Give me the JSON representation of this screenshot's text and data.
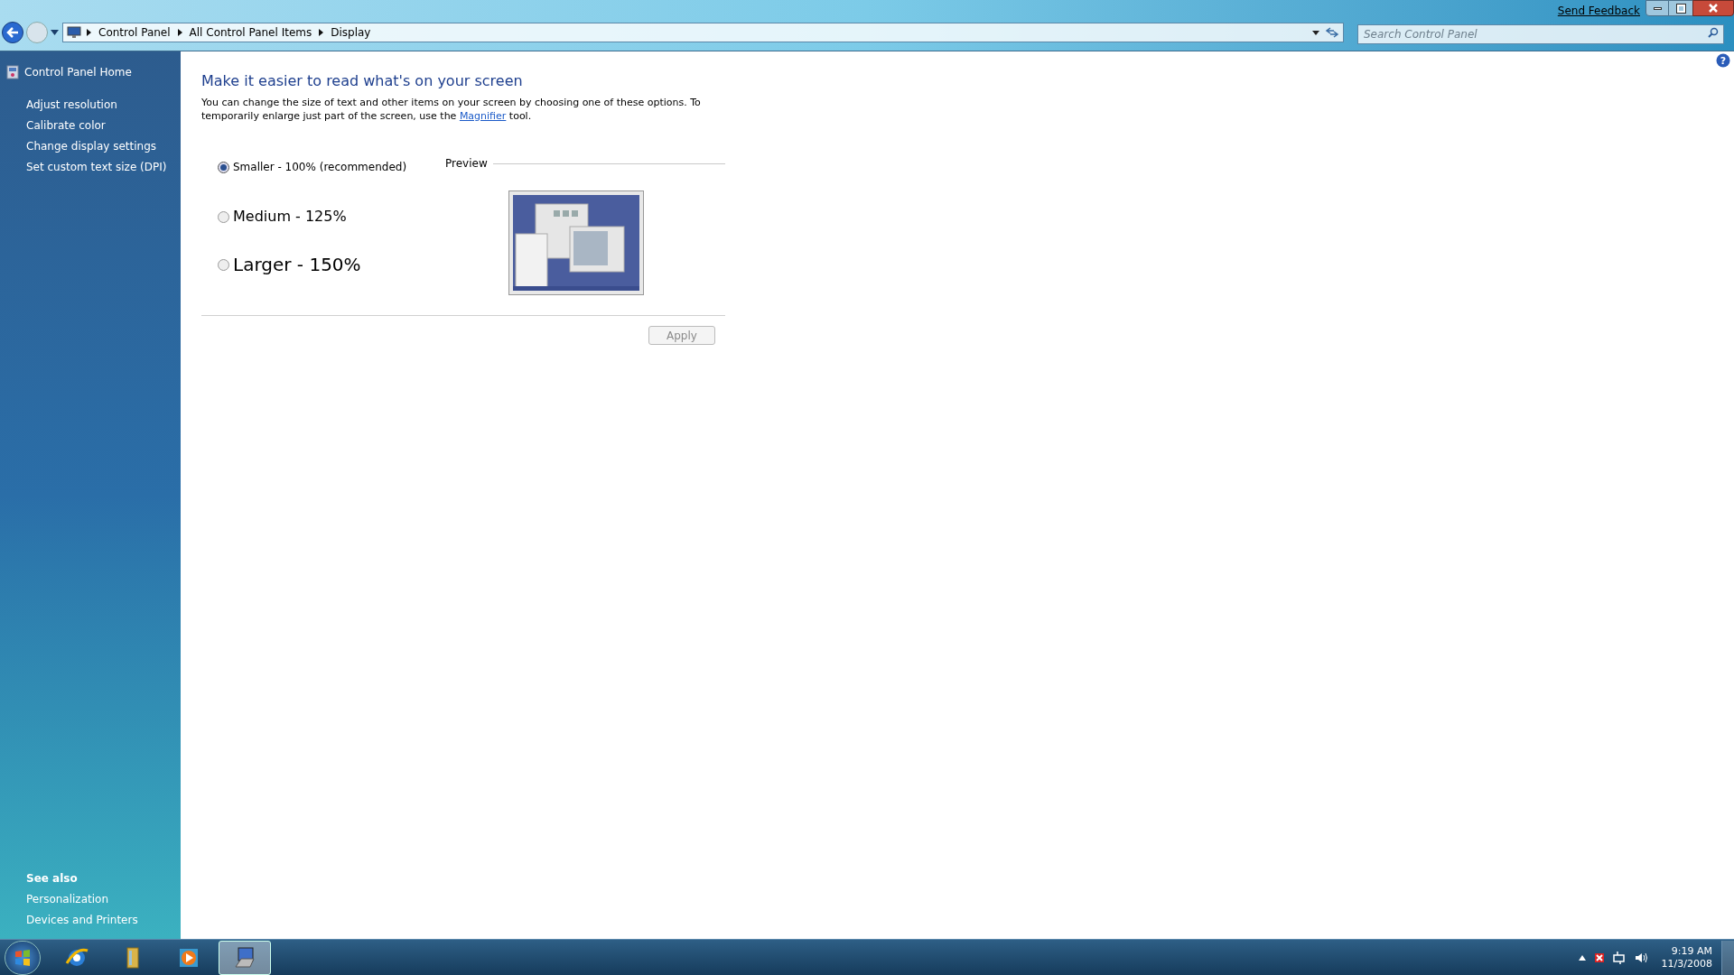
{
  "window": {
    "send_feedback": "Send Feedback"
  },
  "nav": {
    "breadcrumb": [
      "Control Panel",
      "All Control Panel Items",
      "Display"
    ],
    "search": {
      "placeholder": "Search Control Panel"
    }
  },
  "sidebar": {
    "home": "Control Panel Home",
    "tasks": [
      "Adjust resolution",
      "Calibrate color",
      "Change display settings",
      "Set custom text size (DPI)"
    ],
    "see_also": {
      "title": "See also",
      "links": [
        "Personalization",
        "Devices and Printers"
      ]
    }
  },
  "content": {
    "heading": "Make it easier to read what's on your screen",
    "description": {
      "before": "You can change the size of text and other items on your screen by choosing one of these options. To temporarily enlarge just part of the screen, use the ",
      "link": "Magnifier",
      "after": " tool."
    },
    "options": [
      {
        "kind": "small",
        "label": "Smaller - 100% (recommended)",
        "selected": true
      },
      {
        "kind": "medium",
        "label": "Medium - 125%",
        "selected": false
      },
      {
        "kind": "large",
        "label": "Larger - 150%",
        "selected": false
      }
    ],
    "help_glyph": "?",
    "preview_label": "Preview",
    "apply": {
      "label": "Apply",
      "disabled": true
    }
  },
  "taskbar": {
    "apps": [
      {
        "kind": "browser",
        "selected": false
      },
      {
        "kind": "folder",
        "selected": false
      },
      {
        "kind": "media",
        "selected": false
      },
      {
        "kind": "display",
        "selected": true
      }
    ],
    "clock": {
      "time": "9:19 AM",
      "date": "11/3/2008"
    }
  }
}
